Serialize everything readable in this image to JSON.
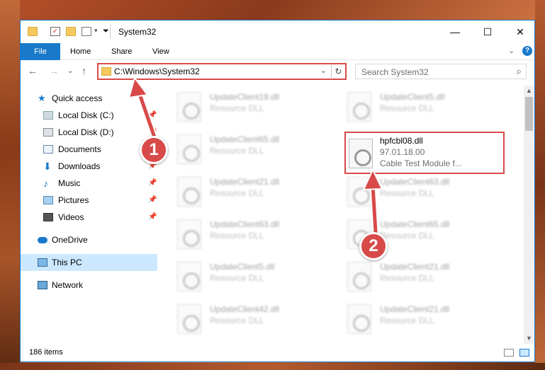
{
  "window": {
    "title": "System32",
    "minimize": "—",
    "maximize": "☐",
    "close": "✕"
  },
  "ribbon": {
    "tabs": [
      "File",
      "Home",
      "Share",
      "View"
    ],
    "expand": "⌄",
    "help": "?"
  },
  "nav": {
    "back": "←",
    "forward": "→",
    "recent": "⌄",
    "up": "↑",
    "address": "C:\\Windows\\System32",
    "address_drop": "⌄",
    "refresh": "↻",
    "search_placeholder": "Search System32",
    "search_icon": "⌕"
  },
  "sidebar": {
    "items": [
      {
        "label": "Quick access",
        "icon": "star-icon",
        "pinned": false
      },
      {
        "label": "Local Disk (C:)",
        "icon": "drive-icon",
        "pinned": true
      },
      {
        "label": "Local Disk (D:)",
        "icon": "drive-icon",
        "pinned": true
      },
      {
        "label": "Documents",
        "icon": "documents-icon",
        "pinned": true
      },
      {
        "label": "Downloads",
        "icon": "download-icon",
        "pinned": true
      },
      {
        "label": "Music",
        "icon": "music-icon",
        "pinned": true
      },
      {
        "label": "Pictures",
        "icon": "pictures-icon",
        "pinned": true
      },
      {
        "label": "Videos",
        "icon": "videos-icon",
        "pinned": true
      },
      {
        "label": "OneDrive",
        "icon": "cloud-icon",
        "pinned": false
      },
      {
        "label": "This PC",
        "icon": "computer-icon",
        "pinned": false,
        "selected": true
      },
      {
        "label": "Network",
        "icon": "network-icon",
        "pinned": false
      }
    ],
    "pin_glyph": "📌"
  },
  "files": {
    "col1": [
      {
        "name": "UpdateClient19.dll",
        "type": "Resource DLL"
      },
      {
        "name": "UpdateClient65.dll",
        "type": "Resource DLL"
      },
      {
        "name": "UpdateClient21.dll",
        "type": "Resource DLL"
      },
      {
        "name": "UpdateClient63.dll",
        "type": "Resource DLL"
      },
      {
        "name": "UpdateClient5.dll",
        "type": "Resource DLL"
      },
      {
        "name": "UpdateClient42.dll",
        "type": "Resource DLL"
      }
    ],
    "col2": [
      {
        "name": "UpdateClient5.dll",
        "type": "Resource DLL"
      },
      {
        "name": "UpdateClient63.dll",
        "type": "Resource DLL"
      },
      {
        "name": "UpdateClient65.dll",
        "type": "Resource DLL"
      },
      {
        "name": "UpdateClient21.dll",
        "type": "Resource DLL"
      },
      {
        "name": "UpdateClient21.dll",
        "type": "Resource DLL"
      }
    ],
    "highlighted": {
      "name": "hpfcbl08.dll",
      "version": "97.01.18.00",
      "description": "Cable Test Module f..."
    }
  },
  "scrollbar": {
    "up": "▲",
    "down": "▼"
  },
  "status": {
    "count": "186 items"
  },
  "annotations": {
    "step1": "1",
    "step2": "2"
  },
  "colors": {
    "accent": "#1979ca",
    "highlight": "#d84a4a",
    "selected": "#cce8ff"
  }
}
